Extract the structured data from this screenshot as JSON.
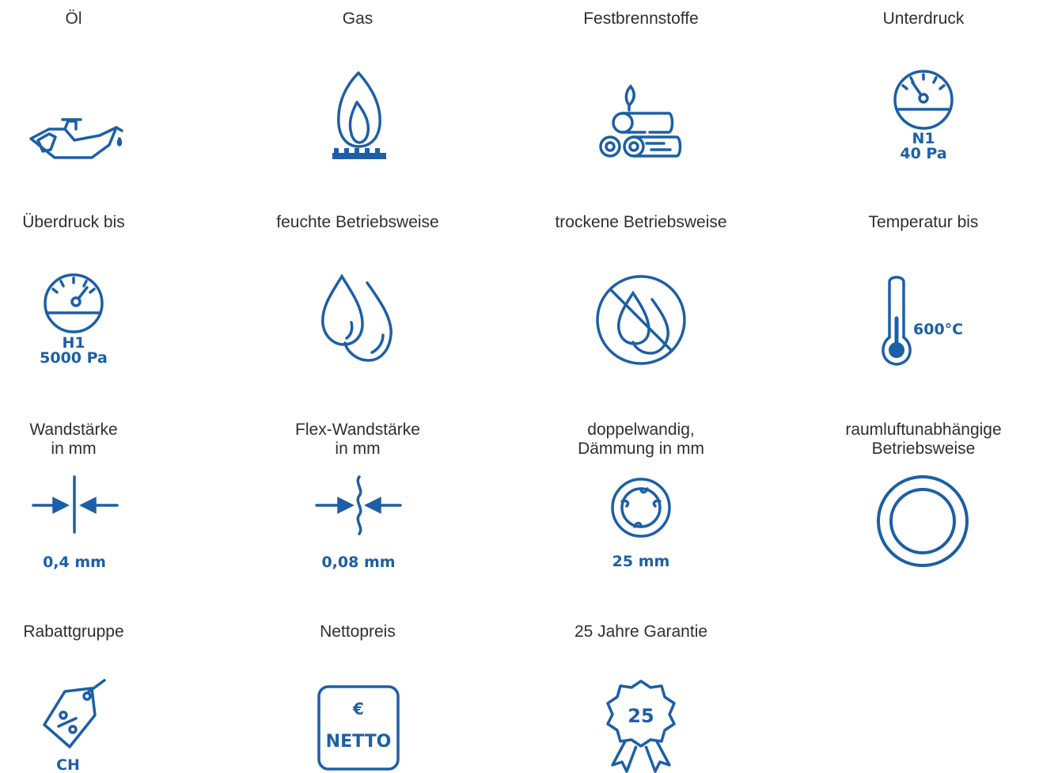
{
  "brand_color": "#1d5fa6",
  "rows": [
    {
      "items": [
        {
          "label": "Öl",
          "icon": "oil-can-icon"
        },
        {
          "label": "Gas",
          "icon": "gas-flame-icon"
        },
        {
          "label": "Festbrennstoffe",
          "icon": "firewood-icon"
        },
        {
          "label": "Unterdruck",
          "icon": "pressure-gauge-icon",
          "icon_text": [
            "N1",
            "40 Pa"
          ]
        }
      ]
    },
    {
      "items": [
        {
          "label": "Überdruck bis",
          "icon": "pressure-gauge-icon",
          "icon_text": [
            "H1",
            "5000 Pa"
          ]
        },
        {
          "label": "feuchte Betriebsweise",
          "icon": "water-drops-icon"
        },
        {
          "label": "trockene Betriebsweise",
          "icon": "no-water-drops-icon"
        },
        {
          "label": "Temperatur bis",
          "icon": "thermometer-icon",
          "icon_text": [
            "600°C"
          ]
        }
      ]
    },
    {
      "items": [
        {
          "label": "Wandstärke\nin mm",
          "icon": "wall-thickness-icon",
          "icon_text": [
            "0,4 mm"
          ]
        },
        {
          "label": "Flex-Wandstärke\nin mm",
          "icon": "flex-wall-thickness-icon",
          "icon_text": [
            "0,08 mm"
          ]
        },
        {
          "label": "doppelwandig,\nDämmung in mm",
          "icon": "insulated-pipe-icon",
          "icon_text": [
            "25 mm"
          ]
        },
        {
          "label": "raumluftunabhängige\nBetriebsweise",
          "icon": "double-ring-icon"
        }
      ]
    },
    {
      "items": [
        {
          "label": "Rabattgruppe",
          "icon": "discount-tag-icon",
          "icon_text": [
            "CH"
          ]
        },
        {
          "label": "Nettopreis",
          "icon": "net-price-icon",
          "icon_text": [
            "€",
            "NETTO"
          ]
        },
        {
          "label": "25 Jahre Garantie",
          "icon": "warranty-badge-icon",
          "icon_text": [
            "25"
          ]
        }
      ]
    }
  ]
}
